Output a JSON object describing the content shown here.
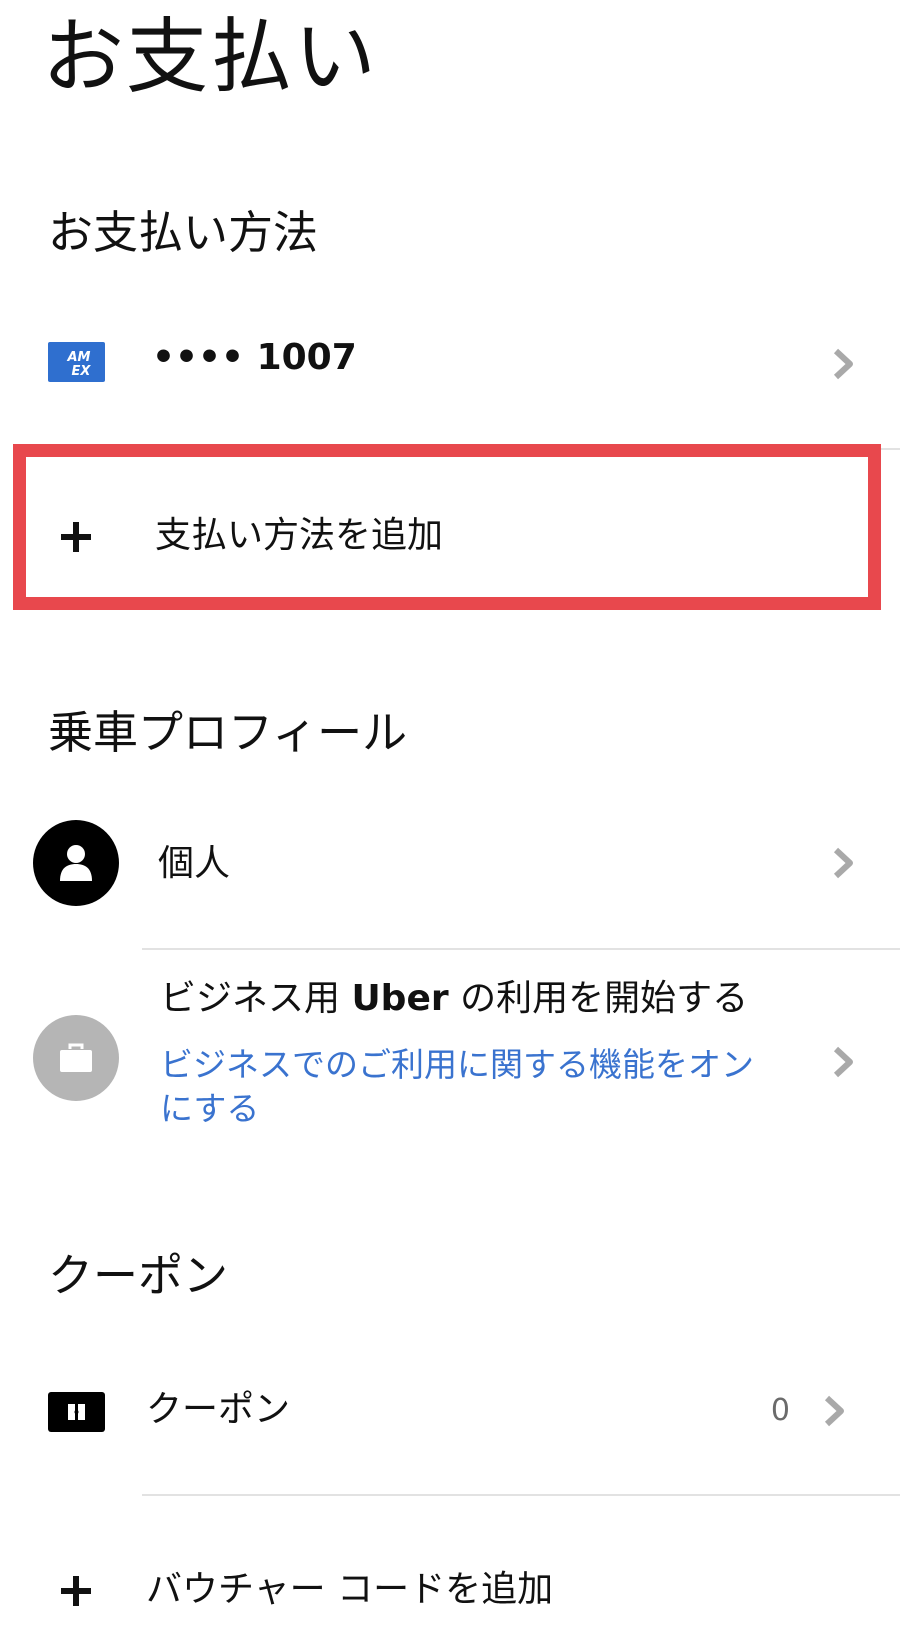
{
  "page": {
    "title": "お支払い"
  },
  "payment_methods": {
    "header": "お支払い方法",
    "card": {
      "icon": "amex-card-icon",
      "masked_number": "•••• 1007"
    },
    "add_label": "支払い方法を追加"
  },
  "ride_profiles": {
    "header": "乗車プロフィール",
    "personal": {
      "icon": "person-icon",
      "label": "個人"
    },
    "business": {
      "icon": "briefcase-icon",
      "title_prefix": "ビジネス用 ",
      "title_brand": "Uber",
      "title_suffix": " の利用を開始する",
      "subtitle": "ビジネスでのご利用に関する機能をオンにする"
    }
  },
  "coupons": {
    "header": "クーポン",
    "item": {
      "icon": "ticket-icon",
      "label": "クーポン",
      "count": "0"
    },
    "add_voucher_label": "バウチャー コードを追加"
  },
  "colors": {
    "accent_blue": "#3a73cf",
    "highlight_red": "#e8484d",
    "amex_blue": "#2f6fcf",
    "disabled_gray": "#b5b5b5"
  }
}
